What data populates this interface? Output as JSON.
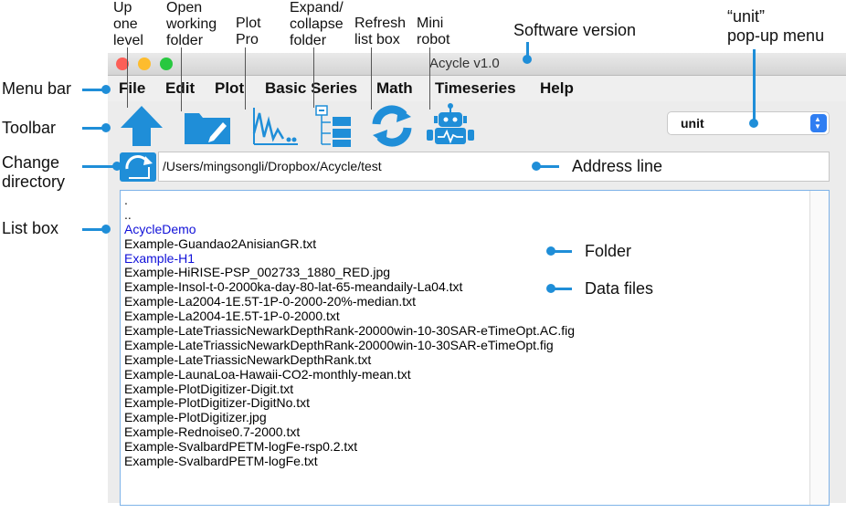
{
  "annotations": {
    "up_level": "Up\none\nlevel",
    "open_folder": "Open\nworking\nfolder",
    "plot_pro": "Plot\nPro",
    "expand_collapse": "Expand/\ncollapse\nfolder",
    "refresh": "Refresh\nlist box",
    "mini_robot": "Mini\nrobot",
    "software_version": "Software version",
    "unit_popup": "“unit”\npop-up menu",
    "menu_bar": "Menu bar",
    "toolbar": "Toolbar",
    "change_directory": "Change\ndirectory",
    "list_box": "List box",
    "address_line": "Address line",
    "folder": "Folder",
    "data_files": "Data files"
  },
  "window": {
    "title": "Acycle v1.0",
    "traffic_colors": [
      "#fc5f57",
      "#fdbc2e",
      "#28c840"
    ]
  },
  "menu": [
    "File",
    "Edit",
    "Plot",
    "Basic Series",
    "Math",
    "Timeseries",
    "Help"
  ],
  "toolbar": {
    "icons": [
      "up-arrow-icon",
      "open-folder-icon",
      "plot-pro-icon",
      "expand-collapse-icon",
      "refresh-icon",
      "robot-icon"
    ],
    "unit_select": "unit",
    "accent": "#1f8ed8"
  },
  "address": {
    "path": "/Users/mingsongli/Dropbox/Acycle/test"
  },
  "list": [
    {
      "name": ".",
      "kind": "nav"
    },
    {
      "name": "..",
      "kind": "nav"
    },
    {
      "name": "AcycleDemo",
      "kind": "folder"
    },
    {
      "name": "Example-Guandao2AnisianGR.txt",
      "kind": "file"
    },
    {
      "name": "Example-H1",
      "kind": "folder"
    },
    {
      "name": "Example-HiRISE-PSP_002733_1880_RED.jpg",
      "kind": "file"
    },
    {
      "name": "Example-Insol-t-0-2000ka-day-80-lat-65-meandaily-La04.txt",
      "kind": "file"
    },
    {
      "name": "Example-La2004-1E.5T-1P-0-2000-20%-median.txt",
      "kind": "file"
    },
    {
      "name": "Example-La2004-1E.5T-1P-0-2000.txt",
      "kind": "file"
    },
    {
      "name": "Example-LateTriassicNewarkDepthRank-20000win-10-30SAR-eTimeOpt.AC.fig",
      "kind": "file"
    },
    {
      "name": "Example-LateTriassicNewarkDepthRank-20000win-10-30SAR-eTimeOpt.fig",
      "kind": "file"
    },
    {
      "name": "Example-LateTriassicNewarkDepthRank.txt",
      "kind": "file"
    },
    {
      "name": "Example-LaunaLoa-Hawaii-CO2-monthly-mean.txt",
      "kind": "file"
    },
    {
      "name": "Example-PlotDigitizer-Digit.txt",
      "kind": "file"
    },
    {
      "name": "Example-PlotDigitizer-DigitNo.txt",
      "kind": "file"
    },
    {
      "name": "Example-PlotDigitizer.jpg",
      "kind": "file"
    },
    {
      "name": "Example-Rednoise0.7-2000.txt",
      "kind": "file"
    },
    {
      "name": "Example-SvalbardPETM-logFe-rsp0.2.txt",
      "kind": "file"
    },
    {
      "name": "Example-SvalbardPETM-logFe.txt",
      "kind": "file"
    }
  ]
}
